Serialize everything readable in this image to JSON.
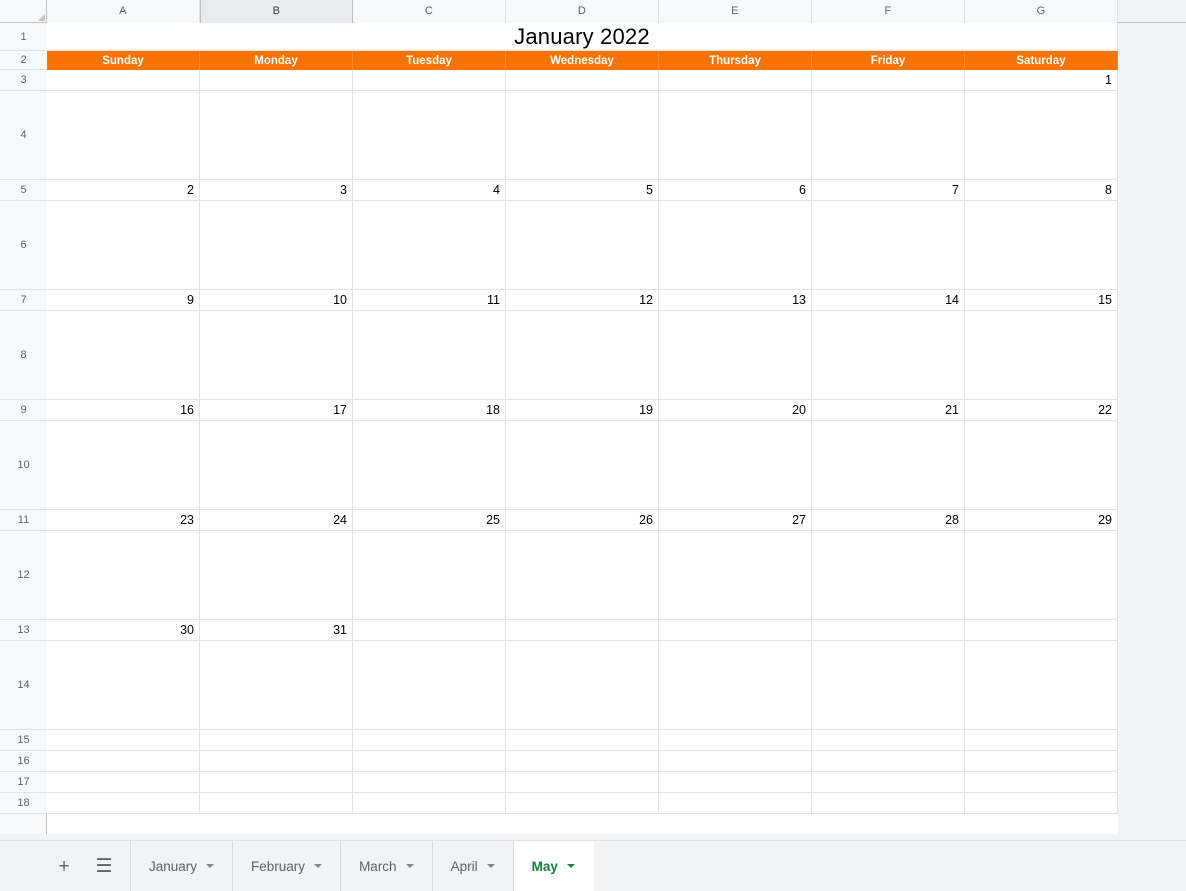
{
  "app": {
    "type": "spreadsheet-calendar",
    "accent_orange": "#F97304",
    "active_tab_green": "#188038"
  },
  "grid": {
    "column_headers": [
      "A",
      "B",
      "C",
      "D",
      "E",
      "F",
      "G"
    ],
    "selected_column": "B",
    "row_headers": [
      "1",
      "2",
      "3",
      "4",
      "5",
      "6",
      "7",
      "8",
      "9",
      "10",
      "11",
      "12",
      "13",
      "14",
      "15",
      "16",
      "17",
      "18"
    ]
  },
  "calendar": {
    "title": "January 2022",
    "day_names": [
      "Sunday",
      "Monday",
      "Tuesday",
      "Wednesday",
      "Thursday",
      "Friday",
      "Saturday"
    ],
    "weeks": [
      [
        "",
        "",
        "",
        "",
        "",
        "",
        "1"
      ],
      [
        "2",
        "3",
        "4",
        "5",
        "6",
        "7",
        "8"
      ],
      [
        "9",
        "10",
        "11",
        "12",
        "13",
        "14",
        "15"
      ],
      [
        "16",
        "17",
        "18",
        "19",
        "20",
        "21",
        "22"
      ],
      [
        "23",
        "24",
        "25",
        "26",
        "27",
        "28",
        "29"
      ],
      [
        "30",
        "31",
        "",
        "",
        "",
        "",
        ""
      ]
    ]
  },
  "tab_bar": {
    "add_sheet_label": "+",
    "all_sheets_label": "☰",
    "tabs": [
      {
        "label": "January",
        "active": false
      },
      {
        "label": "February",
        "active": false
      },
      {
        "label": "March",
        "active": false
      },
      {
        "label": "April",
        "active": false
      },
      {
        "label": "May",
        "active": true
      }
    ]
  }
}
